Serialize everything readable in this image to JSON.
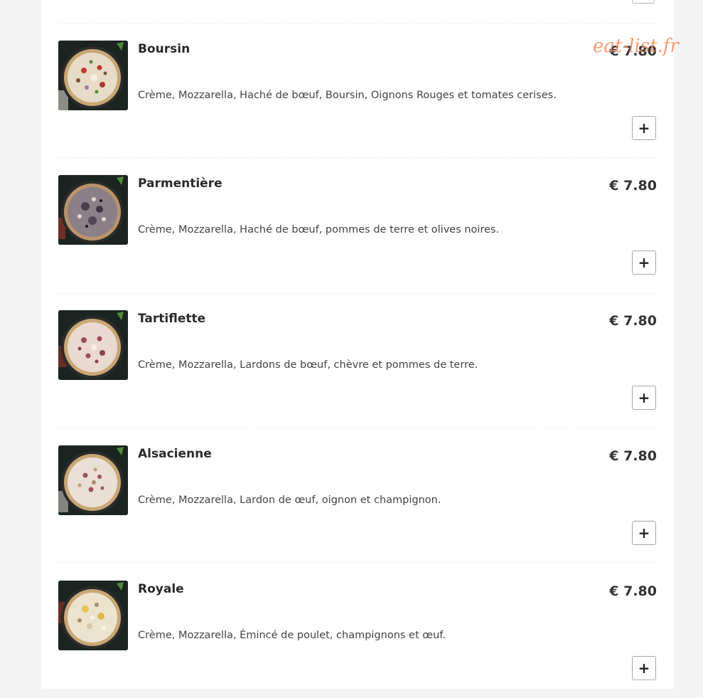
{
  "currency_symbol_note": "",
  "add_button_label": "+",
  "watermark": "eat-list.fr",
  "items": [
    {
      "name": "Boursin",
      "price": "€ 7.80",
      "description": "Crème, Mozzarella, Haché de bœuf, Boursin, Oignons Rouges et tomates cerises."
    },
    {
      "name": "Parmentière",
      "price": "€ 7.80",
      "description": "Crème, Mozzarella, Haché de bœuf, pommes de terre et olives noires."
    },
    {
      "name": "Tartiflette",
      "price": "€ 7.80",
      "description": "Crème, Mozzarella, Lardons de bœuf, chèvre et pommes de terre."
    },
    {
      "name": "Alsacienne",
      "price": "€ 7.80",
      "description": "Crème, Mozzarella, Lardon de œuf, oignon et champignon."
    },
    {
      "name": "Royale",
      "price": "€ 7.80",
      "description": "Crème, Mozzarella, Émincé de poulet, champignons et œuf."
    }
  ],
  "colors": {
    "page_bg": "#f4f4f4",
    "panel_bg": "#ffffff",
    "watermark": "#ef8a5e",
    "text_dark": "#2a2a2a"
  }
}
